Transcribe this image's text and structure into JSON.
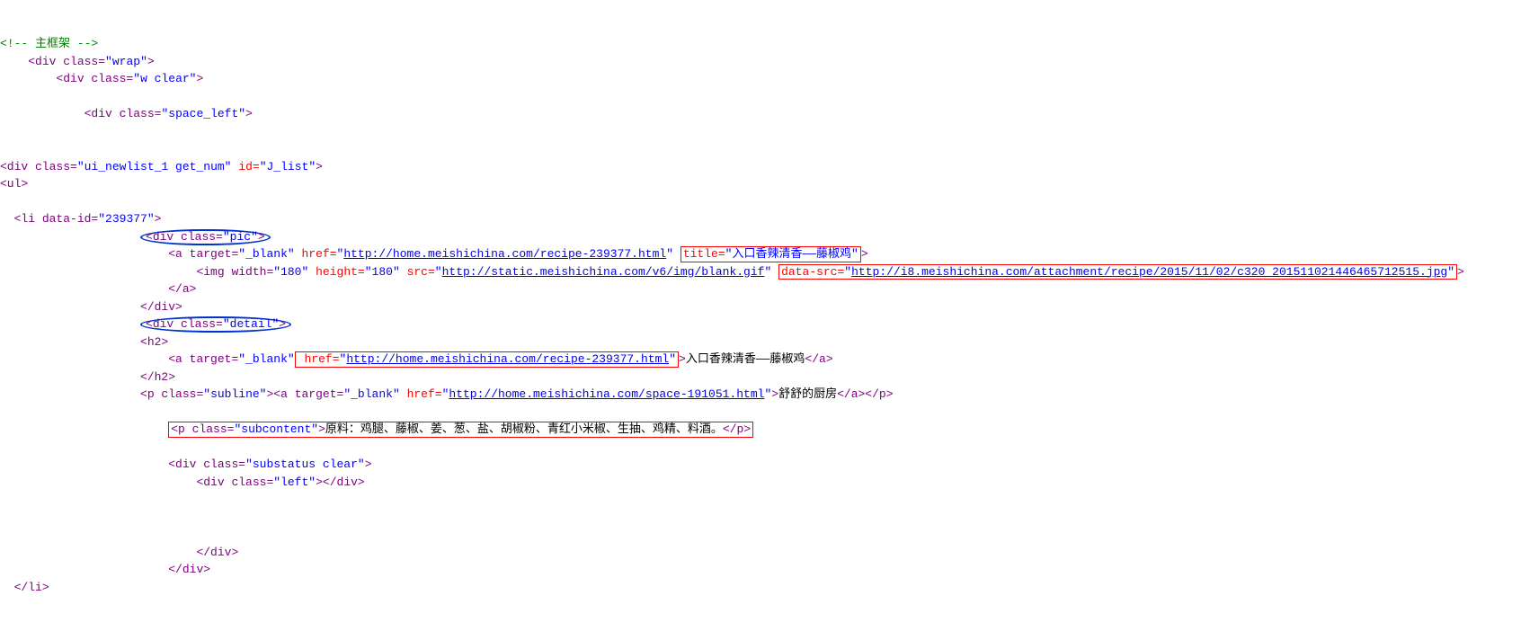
{
  "comment_top": "<!-- 主框架 -->",
  "wrap_class": "wrap",
  "w_class": "w clear",
  "space_left_class": "space_left",
  "list_class": "ui_newlist_1 get_num",
  "list_id": "J_list",
  "li_data_id": "239377",
  "pic_class": "pic",
  "a_target": "_blank",
  "recipe_href": "http://home.meishichina.com/recipe-239377.html",
  "recipe_title": "入口香辣清香——藤椒鸡",
  "img_w": "180",
  "img_h": "180",
  "img_src": "http://static.meishichina.com/v6/img/blank.gif",
  "img_data_src": "http://i8.meishichina.com/attachment/recipe/2015/11/02/c320_201511021446465712515.jpg",
  "detail_class": "detail",
  "h2_link_text": "入口香辣清香——藤椒鸡",
  "subline_class": "subline",
  "space_href": "http://home.meishichina.com/space-191051.html",
  "space_text": "舒舒的厨房",
  "subcontent_class": "subcontent",
  "subcontent_text": "原料：鸡腿、藤椒、姜、葱、盐、胡椒粉、青红小米椒、生抽、鸡精、料酒。",
  "substatus_class": "substatus clear",
  "left_class": "left"
}
